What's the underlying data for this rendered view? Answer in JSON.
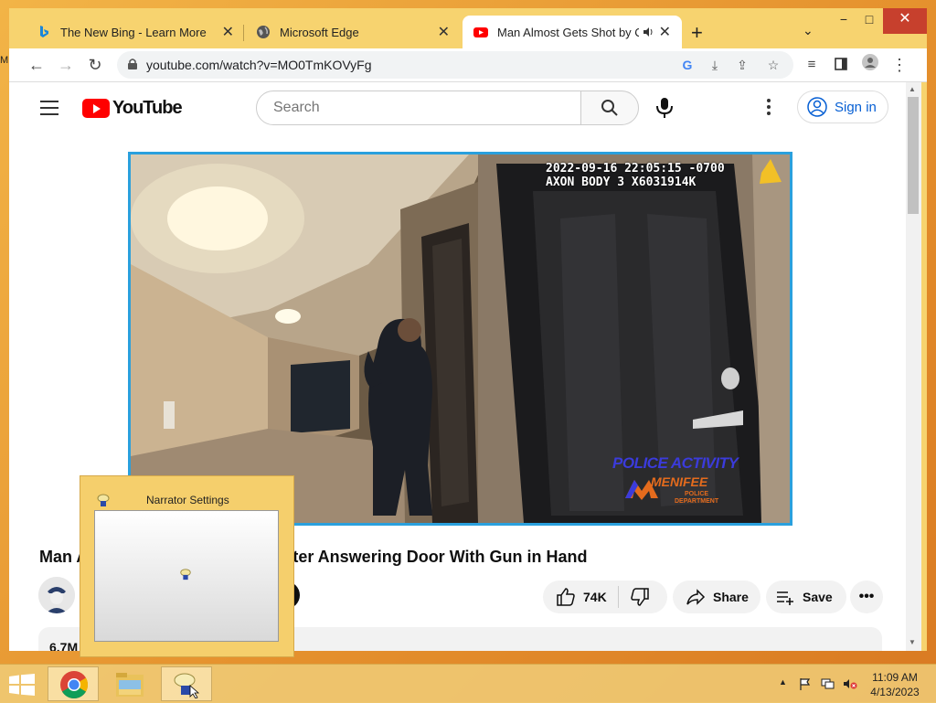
{
  "desktop": {
    "edge_label": "M"
  },
  "tabs": [
    {
      "title": "The New Bing - Learn More",
      "icon": "bing-icon"
    },
    {
      "title": "Microsoft Edge",
      "icon": "globe-icon"
    },
    {
      "title": "Man Almost Gets Shot by Co",
      "icon": "youtube-icon",
      "audio": true
    }
  ],
  "window_controls": {
    "minimize": "−",
    "maximize": "□",
    "close": "✕"
  },
  "toolbar": {
    "url": "youtube.com/watch?v=MO0TmKOVyFg"
  },
  "youtube": {
    "logo_text": "YouTube",
    "search_placeholder": "Search",
    "sign_in": "Sign in",
    "video_title": "Man Almost Gets Shot by Cops After Answering Door With Gun in Hand",
    "video_title_visible_left": "Man A",
    "video_title_visible_right": "fter Answering Door With Gun in Hand",
    "likes": "74K",
    "share": "Share",
    "save": "Save",
    "views_partial": "6.7M"
  },
  "video_overlay": {
    "timestamp": "2022-09-16 22:05:15 -0700",
    "device": "AXON BODY 3 X6031914K",
    "watermark_line1": "POLICE ACTIVITY",
    "watermark_line2": "MENIFEE",
    "watermark_line3": "POLICE\nDEPARTMENT"
  },
  "narrator_popup": {
    "label": "Narrator Settings"
  },
  "taskbar": {
    "apps": [
      "chrome-icon",
      "file-explorer-icon",
      "narrator-icon"
    ],
    "time": "11:09 AM",
    "date": "4/13/2023"
  },
  "colors": {
    "accent_blue": "#2aa0dd",
    "youtube_red": "#ff0000",
    "chrome_frame": "#f7d36f"
  }
}
